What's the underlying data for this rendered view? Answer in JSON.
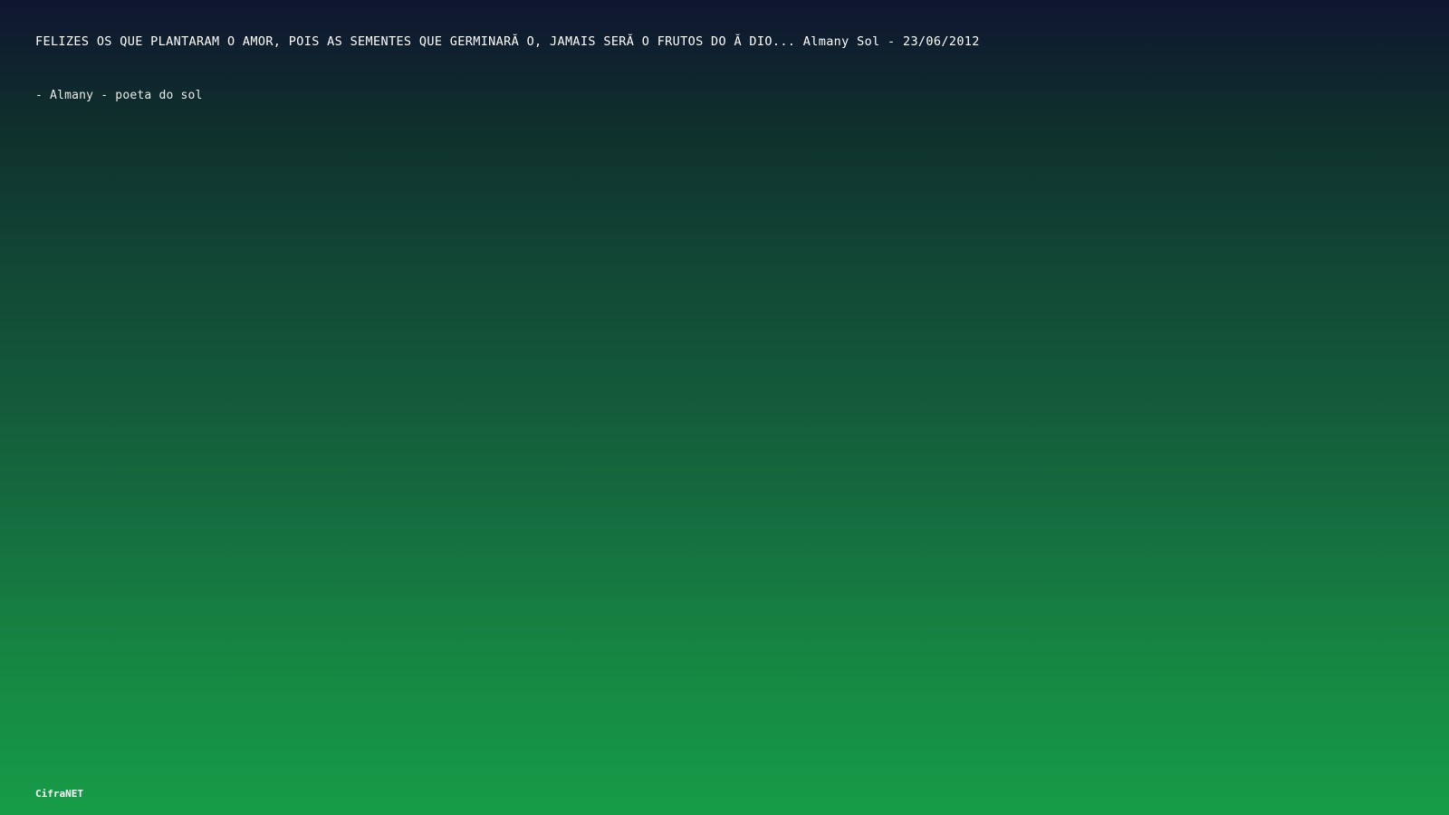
{
  "quote": {
    "text": "FELIZES OS QUE PLANTARAM O AMOR, POIS AS SEMENTES QUE GERMINARĂ O, JAMAIS SERĂ O FRUTOS DO Ă DIO... Almany Sol - 23/06/2012",
    "author": "- Almany - poeta do sol"
  },
  "footer": {
    "brand": "CifraNET"
  },
  "colors": {
    "gradient_top": "#0f1630",
    "gradient_bottom": "#169c47",
    "text": "#ffffff"
  }
}
